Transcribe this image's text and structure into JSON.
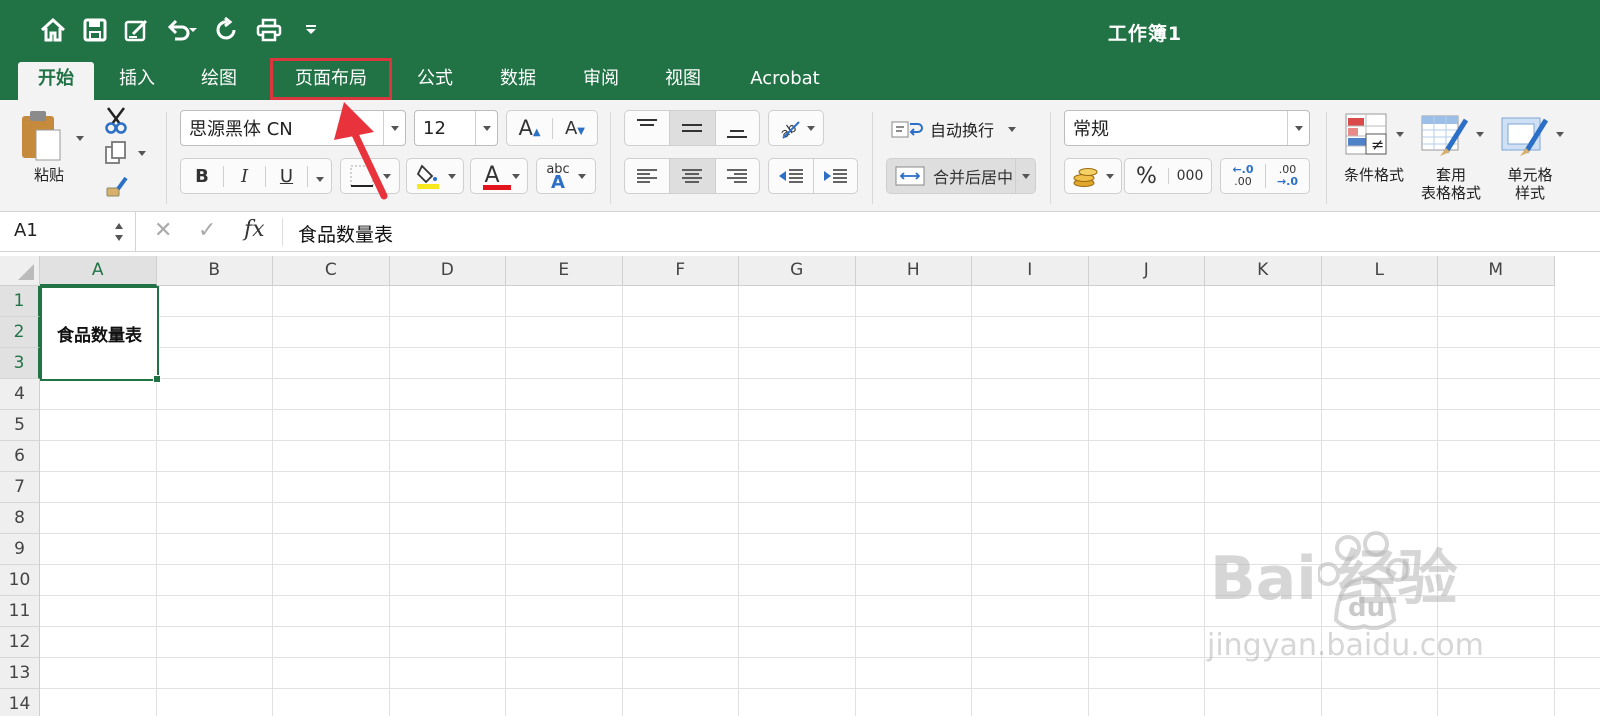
{
  "window": {
    "title": "工作簿1"
  },
  "tabs": [
    {
      "label": "开始",
      "active": true
    },
    {
      "label": "插入"
    },
    {
      "label": "绘图"
    },
    {
      "label": "页面布局",
      "highlighted": true
    },
    {
      "label": "公式"
    },
    {
      "label": "数据"
    },
    {
      "label": "审阅"
    },
    {
      "label": "视图"
    },
    {
      "label": "Acrobat"
    }
  ],
  "ribbon": {
    "paste_label": "粘贴",
    "font_name": "思源黑体 CN",
    "font_size": "12",
    "bold": "B",
    "italic": "I",
    "underline": "U",
    "font_color_glyph": "A",
    "phonetic_small": "abc",
    "phonetic_big": "A",
    "wrap_text": "自动换行",
    "merge_center": "合并后居中",
    "number_format": "常规",
    "percent": "%",
    "comma": "000",
    "inc_decimal_top": "←.0",
    "inc_decimal_bottom": ".00",
    "dec_decimal_top": ".00",
    "dec_decimal_bottom": "→.0",
    "conditional_format": "条件格式",
    "format_as_table_1": "套用",
    "format_as_table_2": "表格格式",
    "cell_styles_1": "单元格",
    "cell_styles_2": "样式",
    "grow_font": "A",
    "shrink_font": "A"
  },
  "formula_bar": {
    "name_box": "A1",
    "cancel_glyph": "✕",
    "enter_glyph": "✓",
    "fx": "fx",
    "content": "食品数量表"
  },
  "sheet": {
    "columns": [
      "A",
      "B",
      "C",
      "D",
      "E",
      "F",
      "G",
      "H",
      "I",
      "J",
      "K",
      "L",
      "M"
    ],
    "rows": [
      "1",
      "2",
      "3",
      "4",
      "5",
      "6",
      "7",
      "8",
      "9",
      "10",
      "11",
      "12",
      "13",
      "14"
    ],
    "merged_cell_text": "食品数量表"
  },
  "watermark": {
    "main": "Bai  经验",
    "du": "du",
    "sub": "jingyan.baidu.com"
  },
  "colors": {
    "excel_green": "#217346",
    "highlight_red": "#d9363e",
    "arrow_red": "#e8323c"
  }
}
